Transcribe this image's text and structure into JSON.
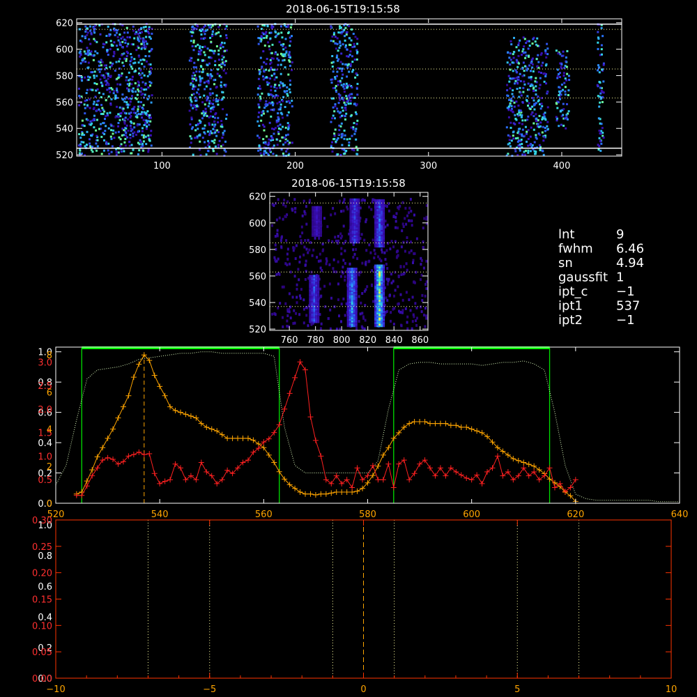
{
  "colors": {
    "background": "#000000",
    "axis_white": "#ffffff",
    "axis_red": "#ff0000",
    "axis_orange": "#ffa500",
    "green": "#00ff00",
    "dotted_white": "#ffffc0",
    "map_low": "#3000a0",
    "map_mid": "#2080ff",
    "map_high": "#60ffa0"
  },
  "panel1": {
    "title": "2018-06-15T19:15:58",
    "type": "heatmap",
    "xlim": [
      36,
      445
    ],
    "ylim": [
      519,
      623
    ],
    "xticks": [
      100,
      200,
      300,
      400
    ],
    "yticks": [
      520,
      540,
      560,
      580,
      600,
      620
    ],
    "x_tick_labels": [
      "100",
      "200",
      "300",
      "400"
    ],
    "y_tick_labels": [
      "520",
      "540",
      "560",
      "580",
      "600",
      "620"
    ],
    "hlines_solid": [
      525,
      619
    ],
    "hlines_dotted": [
      563,
      585,
      615
    ],
    "columns": [
      {
        "x0": 37,
        "x1": 92,
        "y0": 520,
        "y1": 620
      },
      {
        "x0": 120,
        "x1": 148,
        "y0": 520,
        "y1": 620
      },
      {
        "x0": 171,
        "x1": 197,
        "y0": 520,
        "y1": 620
      },
      {
        "x0": 226,
        "x1": 246,
        "y0": 520,
        "y1": 620
      },
      {
        "x0": 358,
        "x1": 389,
        "y0": 520,
        "y1": 610
      },
      {
        "x0": 395,
        "x1": 405,
        "y0": 540,
        "y1": 600
      },
      {
        "x0": 426,
        "x1": 431,
        "y0": 520,
        "y1": 620
      }
    ]
  },
  "panel2": {
    "title": "2018-06-15T19:15:58",
    "type": "heatmap",
    "xlim": [
      745,
      866
    ],
    "ylim": [
      519,
      623
    ],
    "xticks": [
      760,
      780,
      800,
      820,
      840,
      860
    ],
    "yticks": [
      520,
      540,
      560,
      580,
      600,
      620
    ],
    "x_tick_labels": [
      "760",
      "780",
      "800",
      "820",
      "840",
      "860"
    ],
    "y_tick_labels": [
      "520",
      "540",
      "560",
      "580",
      "600",
      "620"
    ],
    "hlines_dotted": [
      537,
      563,
      585,
      615
    ],
    "streaks": [
      {
        "x": 779,
        "y0": 525,
        "y1": 560,
        "peak": 0.55
      },
      {
        "x": 781,
        "y0": 590,
        "y1": 612,
        "peak": 0.3
      },
      {
        "x": 808,
        "y0": 522,
        "y1": 566,
        "peak": 0.75
      },
      {
        "x": 810,
        "y0": 585,
        "y1": 618,
        "peak": 0.5
      },
      {
        "x": 829,
        "y0": 522,
        "y1": 568,
        "peak": 1.0
      },
      {
        "x": 829,
        "y0": 582,
        "y1": 618,
        "peak": 0.6
      }
    ]
  },
  "info": [
    {
      "label": "lnt",
      "value": "9"
    },
    {
      "label": "fwhm",
      "value": "6.46"
    },
    {
      "label": "sn",
      "value": "4.94"
    },
    {
      "label": "gaussfit",
      "value": "1"
    },
    {
      "label": "ipt_c",
      "value": "−1"
    },
    {
      "label": "ipt1",
      "value": "537"
    },
    {
      "label": "ipt2",
      "value": "−1"
    }
  ],
  "chart_data": [
    {
      "type": "line",
      "xlim": [
        520,
        640
      ],
      "xticks": [
        "520",
        "540",
        "560",
        "580",
        "600",
        "620",
        "640"
      ],
      "yticks_white_labels": [
        "0.0",
        "0.2",
        "0.4",
        "0.6",
        "0.8",
        "1.0"
      ],
      "yticks_red_labels": [
        "0.5",
        "1.0",
        "1.5",
        "2.0",
        "2.5",
        "3.0"
      ],
      "yticks_orange_labels": [
        "0",
        "2",
        "4",
        "6",
        "8"
      ],
      "vline_dashed_orange": 537,
      "green_boxes": [
        [
          525,
          563
        ],
        [
          585,
          615
        ]
      ],
      "series": [
        {
          "x": [
            520,
            522,
            524,
            526,
            528,
            530,
            532,
            534,
            536,
            538,
            540,
            542,
            544,
            546,
            548,
            550,
            552,
            554,
            556,
            558,
            560,
            562,
            564,
            566,
            568,
            570,
            572,
            574,
            576,
            578,
            580,
            582,
            584,
            586,
            588,
            590,
            592,
            594,
            596,
            598,
            600,
            602,
            604,
            606,
            608,
            610,
            612,
            614,
            616,
            618,
            620,
            622,
            624,
            626,
            628,
            630,
            632,
            634,
            636,
            638,
            640
          ],
          "y": [
            0.12,
            0.25,
            0.55,
            0.82,
            0.88,
            0.89,
            0.9,
            0.92,
            0.95,
            0.96,
            0.97,
            0.98,
            0.99,
            0.99,
            1.0,
            1.0,
            0.99,
            0.99,
            0.99,
            0.99,
            0.99,
            0.97,
            0.5,
            0.25,
            0.2,
            0.2,
            0.2,
            0.2,
            0.2,
            0.2,
            0.2,
            0.28,
            0.62,
            0.88,
            0.92,
            0.93,
            0.93,
            0.92,
            0.92,
            0.92,
            0.92,
            0.91,
            0.92,
            0.93,
            0.93,
            0.94,
            0.92,
            0.88,
            0.6,
            0.25,
            0.06,
            0.03,
            0.02,
            0.02,
            0.02,
            0.02,
            0.02,
            0.02,
            0.01,
            0.01,
            0.01
          ]
        },
        {
          "x": [
            524,
            525,
            526,
            527,
            528,
            529,
            530,
            531,
            532,
            533,
            534,
            535,
            536,
            537,
            538,
            539,
            540,
            541,
            542,
            543,
            544,
            545,
            546,
            547,
            548,
            549,
            550,
            551,
            552,
            553,
            554,
            555,
            556,
            557,
            558,
            559,
            560,
            561,
            562,
            563,
            564,
            565,
            566,
            567,
            568,
            569,
            570,
            571,
            572,
            573,
            574,
            575,
            576,
            577,
            578,
            579,
            580,
            581,
            582,
            583,
            584,
            585,
            586,
            587,
            588,
            589,
            590,
            591,
            592,
            593,
            594,
            595,
            596,
            597,
            598,
            599,
            600,
            601,
            602,
            603,
            604,
            605,
            606,
            607,
            608,
            609,
            610,
            611,
            612,
            613,
            614,
            615,
            616,
            617,
            618,
            619,
            620
          ],
          "y": [
            0.1,
            0.1,
            0.22,
            0.35,
            0.45,
            0.55,
            0.58,
            0.56,
            0.5,
            0.53,
            0.6,
            0.62,
            0.65,
            0.62,
            0.63,
            0.38,
            0.25,
            0.28,
            0.3,
            0.5,
            0.45,
            0.3,
            0.35,
            0.3,
            0.52,
            0.4,
            0.35,
            0.25,
            0.3,
            0.42,
            0.38,
            0.45,
            0.52,
            0.55,
            0.65,
            0.7,
            0.78,
            0.82,
            0.9,
            1.0,
            1.2,
            1.4,
            1.6,
            1.8,
            1.7,
            1.1,
            0.8,
            0.6,
            0.3,
            0.25,
            0.35,
            0.25,
            0.3,
            0.2,
            0.45,
            0.3,
            0.35,
            0.48,
            0.3,
            0.3,
            0.5,
            0.2,
            0.5,
            0.55,
            0.3,
            0.38,
            0.5,
            0.55,
            0.45,
            0.35,
            0.45,
            0.35,
            0.45,
            0.4,
            0.36,
            0.32,
            0.3,
            0.36,
            0.25,
            0.4,
            0.45,
            0.6,
            0.35,
            0.4,
            0.3,
            0.35,
            0.45,
            0.35,
            0.4,
            0.3,
            0.35,
            0.45,
            0.2,
            0.25,
            0.15,
            0.2,
            0.3
          ]
        },
        {
          "x": [
            524,
            525,
            526,
            527,
            528,
            529,
            530,
            531,
            532,
            533,
            534,
            535,
            536,
            537,
            538,
            539,
            540,
            541,
            542,
            543,
            544,
            545,
            546,
            547,
            548,
            549,
            550,
            551,
            552,
            553,
            554,
            555,
            556,
            557,
            558,
            559,
            560,
            561,
            562,
            563,
            564,
            565,
            566,
            567,
            568,
            569,
            570,
            571,
            572,
            573,
            574,
            575,
            576,
            577,
            578,
            579,
            580,
            581,
            582,
            583,
            584,
            585,
            586,
            587,
            588,
            589,
            590,
            591,
            592,
            593,
            594,
            595,
            596,
            597,
            598,
            599,
            600,
            601,
            602,
            603,
            604,
            605,
            606,
            607,
            608,
            609,
            610,
            611,
            612,
            613,
            614,
            615,
            616,
            617,
            618,
            619,
            620
          ],
          "y": [
            0.5,
            0.6,
            1.2,
            1.8,
            2.5,
            3.0,
            3.5,
            4.0,
            4.6,
            5.2,
            5.8,
            6.8,
            7.5,
            8.0,
            7.7,
            6.9,
            6.3,
            5.8,
            5.2,
            5.0,
            4.9,
            4.8,
            4.7,
            4.6,
            4.3,
            4.1,
            4.0,
            3.9,
            3.7,
            3.5,
            3.5,
            3.5,
            3.5,
            3.5,
            3.4,
            3.2,
            3.0,
            2.6,
            2.2,
            1.7,
            1.3,
            1.0,
            0.8,
            0.6,
            0.5,
            0.5,
            0.45,
            0.5,
            0.5,
            0.55,
            0.6,
            0.6,
            0.6,
            0.6,
            0.65,
            0.8,
            1.1,
            1.5,
            2.0,
            2.6,
            3.0,
            3.5,
            3.8,
            4.1,
            4.3,
            4.4,
            4.4,
            4.4,
            4.3,
            4.3,
            4.3,
            4.3,
            4.2,
            4.2,
            4.1,
            4.1,
            4.0,
            3.9,
            3.8,
            3.6,
            3.3,
            3.0,
            2.8,
            2.6,
            2.4,
            2.3,
            2.2,
            2.1,
            2.0,
            1.8,
            1.6,
            1.3,
            1.1,
            0.9,
            0.6,
            0.4,
            0.1
          ]
        }
      ]
    },
    {
      "type": "line",
      "xlim": [
        -10,
        10
      ],
      "xticks": [
        "−10",
        "−5",
        "0",
        "5",
        "10"
      ],
      "xtick_values": [
        -10,
        -5,
        0,
        5,
        10
      ],
      "yticks_white_labels": [
        "0.0",
        "0.2",
        "0.4",
        "0.6",
        "0.8",
        "1.0"
      ],
      "yticks_red_labels": [
        "0.00",
        "0.05",
        "0.10",
        "0.15",
        "0.20",
        "0.25",
        "0.30"
      ],
      "vlines_dotted": [
        -7,
        -5,
        -1,
        1,
        5,
        7
      ],
      "vline_dashed_orange": 0
    }
  ]
}
